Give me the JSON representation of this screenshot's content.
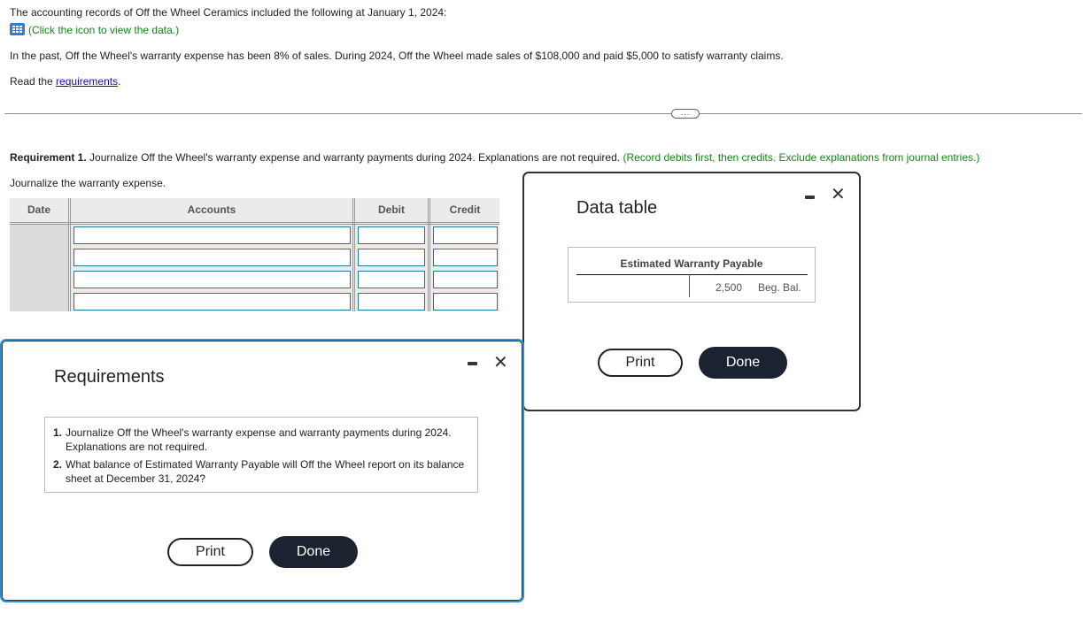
{
  "intro": {
    "line1": "The accounting records of Off the Wheel Ceramics included the following at January 1, 2024:",
    "data_icon": "grid-table-icon",
    "data_link": "(Click the icon to view the data.)",
    "line2": "In the past, Off the Wheel's warranty expense has been 8% of sales. During 2024, Off the Wheel made sales of $108,000 and paid $5,000 to satisfy warranty claims.",
    "read_prefix": "Read the ",
    "read_link": "requirements",
    "read_suffix": "."
  },
  "divider": {
    "expand_label": "..."
  },
  "requirement1": {
    "bold": "Requirement 1.",
    "text": " Journalize Off the Wheel's warranty expense and warranty payments during 2024. Explanations are not required.",
    "hint": "(Record debits first, then credits. Exclude explanations from journal entries.)",
    "subheading": "Journalize the warranty expense."
  },
  "journal": {
    "headers": {
      "date": "Date",
      "accounts": "Accounts",
      "debit": "Debit",
      "credit": "Credit"
    },
    "rows": [
      {
        "account": "",
        "debit": "",
        "credit": ""
      },
      {
        "account": "",
        "debit": "",
        "credit": ""
      },
      {
        "account": "",
        "debit": "",
        "credit": ""
      },
      {
        "account": "",
        "debit": "",
        "credit": ""
      }
    ]
  },
  "data_modal": {
    "title": "Data table",
    "account_title": "Estimated Warranty Payable",
    "credit_amount": "2,500",
    "credit_label": "Beg. Bal.",
    "print": "Print",
    "done": "Done"
  },
  "req_modal": {
    "title": "Requirements",
    "items": [
      {
        "num": "1.",
        "text": "Journalize Off the Wheel's warranty expense and warranty payments during 2024. Explanations are not required."
      },
      {
        "num": "2.",
        "text": "What balance of Estimated Warranty Payable will Off the Wheel report on its balance sheet at December 31, 2024?"
      }
    ],
    "print": "Print",
    "done": "Done"
  }
}
